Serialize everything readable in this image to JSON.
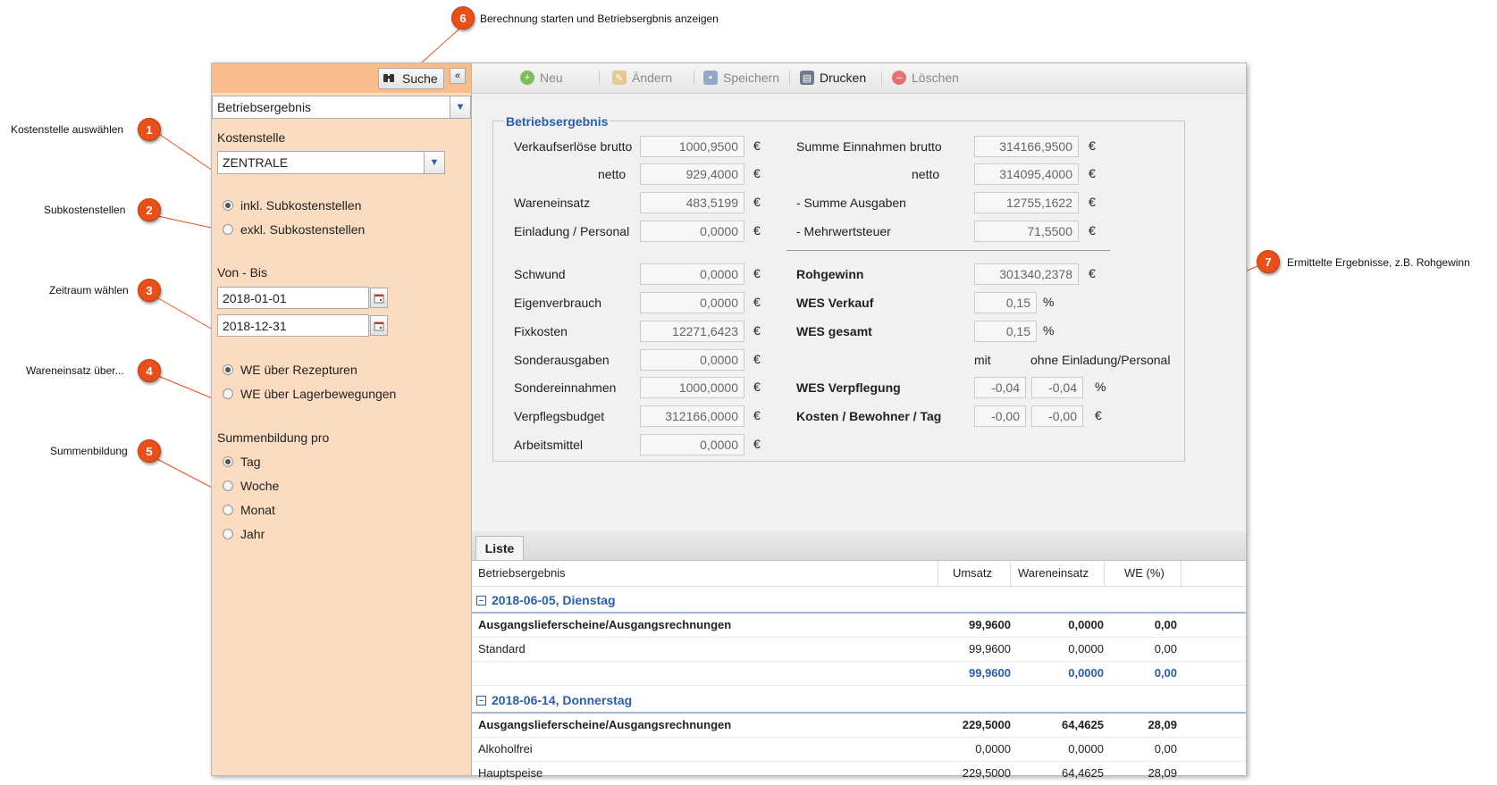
{
  "callouts": [
    {
      "n": "6",
      "text": "Berechnung starten und Betriebsergbnis anzeigen"
    },
    {
      "n": "1",
      "text": "Kostenstelle auswählen"
    },
    {
      "n": "2",
      "text": "Subkostenstellen"
    },
    {
      "n": "3",
      "text": "Zeitraum wählen"
    },
    {
      "n": "4",
      "text": "Wareneinsatz über..."
    },
    {
      "n": "5",
      "text": "Summenbildung"
    },
    {
      "n": "7",
      "text": "Ermittelte Ergebnisse, z.B. Rohgewinn"
    }
  ],
  "left_panel": {
    "search_label": "Suche",
    "collapse_glyph": "«",
    "report_select": "Betriebsergebnis",
    "kostenstelle_label": "Kostenstelle",
    "kostenstelle_value": "ZENTRALE",
    "sub_options": [
      "inkl. Subkostenstellen",
      "exkl. Subkostenstellen"
    ],
    "period_label": "Von - Bis",
    "date_from": "2018-01-01",
    "date_to": "2018-12-31",
    "we_options": [
      "WE über Rezepturen",
      "WE über Lagerbewegungen"
    ],
    "sum_label": "Summenbildung pro",
    "sum_options": [
      "Tag",
      "Woche",
      "Monat",
      "Jahr"
    ]
  },
  "toolbar": {
    "neu": "Neu",
    "aendern": "Ändern",
    "speichern": "Speichern",
    "drucken": "Drucken",
    "loeschen": "Löschen"
  },
  "form": {
    "legend": "Betriebsergebnis",
    "currency": "€",
    "percent": "%",
    "left": [
      {
        "label": "Verkaufserlöse brutto",
        "value": "1000,9500"
      },
      {
        "label": "netto",
        "value": "929,4000"
      },
      {
        "label": "Wareneinsatz",
        "value": "483,5199"
      },
      {
        "label": "Einladung / Personal",
        "value": "0,0000"
      },
      {
        "label": "Schwund",
        "value": "0,0000"
      },
      {
        "label": "Eigenverbrauch",
        "value": "0,0000"
      },
      {
        "label": "Fixkosten",
        "value": "12271,6423"
      },
      {
        "label": "Sonderausgaben",
        "value": "0,0000"
      },
      {
        "label": "Sondereinnahmen",
        "value": "1000,0000"
      },
      {
        "label": "Verpflegsbudget",
        "value": "312166,0000"
      },
      {
        "label": "Arbeitsmittel",
        "value": "0,0000"
      }
    ],
    "right": [
      {
        "label": "Summe Einnahmen brutto",
        "value": "314166,9500"
      },
      {
        "label": "netto",
        "value": "314095,4000"
      },
      {
        "label": "- Summe Ausgaben",
        "value": "12755,1622"
      },
      {
        "label": "- Mehrwertsteuer",
        "value": "71,5500"
      },
      {
        "label": "Rohgewinn",
        "value": "301340,2378"
      },
      {
        "label": "WES Verkauf",
        "value": "0,15"
      },
      {
        "label": "WES gesamt",
        "value": "0,15"
      }
    ],
    "mit_label": "mit",
    "ohne_label": "ohne Einladung/Personal",
    "wes_verpflegung": {
      "label": "WES Verpflegung",
      "mit": "-0,04",
      "ohne": "-0,04"
    },
    "kosten_bewohner": {
      "label": "Kosten / Bewohner / Tag",
      "mit": "-0,00",
      "ohne": "-0,00"
    }
  },
  "list": {
    "tab": "Liste",
    "headers": [
      "Betriebsergebnis",
      "Umsatz",
      "Wareneinsatz",
      "WE (%)"
    ],
    "groups": [
      {
        "title": "2018-06-05, Dienstag",
        "rows": [
          {
            "name": "Ausgangslieferscheine/Ausgangsrechnungen",
            "umsatz": "99,9600",
            "we": "0,0000",
            "pct": "0,00"
          },
          {
            "name": "Standard",
            "umsatz": "99,9600",
            "we": "0,0000",
            "pct": "0,00"
          },
          {
            "name": "",
            "umsatz": "99,9600",
            "we": "0,0000",
            "pct": "0,00"
          }
        ]
      },
      {
        "title": "2018-06-14, Donnerstag",
        "rows": [
          {
            "name": "Ausgangslieferscheine/Ausgangsrechnungen",
            "umsatz": "229,5000",
            "we": "64,4625",
            "pct": "28,09"
          },
          {
            "name": "Alkoholfrei",
            "umsatz": "0,0000",
            "we": "0,0000",
            "pct": "0,00"
          },
          {
            "name": "Hauptspeise",
            "umsatz": "229,5000",
            "we": "64,4625",
            "pct": "28,09"
          }
        ]
      }
    ]
  }
}
